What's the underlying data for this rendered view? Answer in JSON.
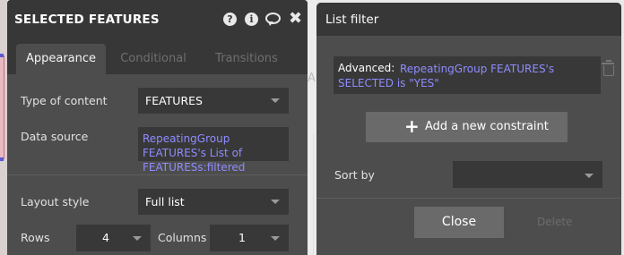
{
  "properties_panel": {
    "title": "SELECTED FEATURES",
    "header_icons": [
      "help-icon",
      "info-icon",
      "comment-icon",
      "close-icon"
    ],
    "help_glyph": "?",
    "info_glyph": "i",
    "close_glyph": "✖",
    "tabs": [
      {
        "label": "Appearance",
        "active": true
      },
      {
        "label": "Conditional",
        "active": false
      },
      {
        "label": "Transitions",
        "active": false
      }
    ],
    "type_of_content": {
      "label": "Type of content",
      "value": "FEATURES"
    },
    "data_source": {
      "label": "Data source",
      "value": "RepeatingGroup FEATURES's List of FEATURESs:filtered"
    },
    "layout_style": {
      "label": "Layout style",
      "value": "Full list"
    },
    "rows": {
      "label": "Rows",
      "value": "4"
    },
    "columns": {
      "label": "Columns",
      "value": "1"
    }
  },
  "list_filter": {
    "title": "List filter",
    "constraint": {
      "label": "Advanced:",
      "expression": "RepeatingGroup FEATURES's SELECTED is \"YES\""
    },
    "add_constraint_label": "Add a new constraint",
    "plus_glyph": "+",
    "sort_by": {
      "label": "Sort by",
      "value": ""
    },
    "close_label": "Close",
    "delete_label": "Delete"
  },
  "colors": {
    "panel_bg": "#4d4d4d",
    "header_bg": "#373737",
    "expression_accent": "#8f8cff"
  }
}
